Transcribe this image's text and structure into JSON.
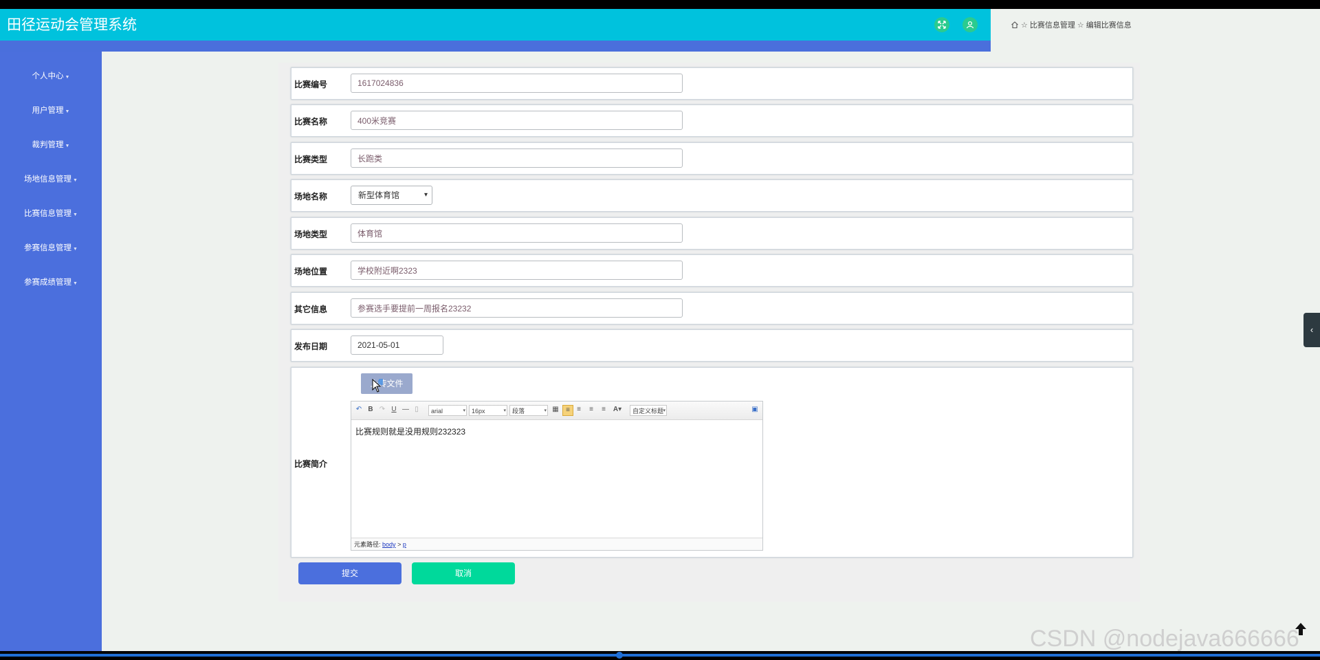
{
  "header": {
    "title": "田径运动会管理系统"
  },
  "breadcrumb": [
    "比赛信息管理",
    "编辑比赛信息"
  ],
  "sidebar": {
    "items": [
      {
        "label": "个人中心"
      },
      {
        "label": "用户管理"
      },
      {
        "label": "裁判管理"
      },
      {
        "label": "场地信息管理"
      },
      {
        "label": "比赛信息管理"
      },
      {
        "label": "参赛信息管理"
      },
      {
        "label": "参赛成绩管理"
      }
    ]
  },
  "form": {
    "match_no": {
      "label": "比赛编号",
      "value": "1617024836"
    },
    "match_name": {
      "label": "比赛名称",
      "value": "400米竞赛"
    },
    "match_type": {
      "label": "比赛类型",
      "value": "长跑类"
    },
    "venue_name": {
      "label": "场地名称",
      "value": "新型体育馆"
    },
    "venue_type": {
      "label": "场地类型",
      "value": "体育馆"
    },
    "venue_location": {
      "label": "场地位置",
      "value": "学校附近啊2323"
    },
    "other_info": {
      "label": "其它信息",
      "value": "参赛选手要提前一周报名23232"
    },
    "publish_date": {
      "label": "发布日期",
      "value": "2021-05-01"
    },
    "intro": {
      "label": "比赛简介",
      "upload_label": "上传文件",
      "toolbar": {
        "font": "arial",
        "size": "16px",
        "paragraph": "段落",
        "custom_title": "自定义标题"
      },
      "content": "比赛规则就是没用规则232323",
      "status_prefix": "元素路径:",
      "path_body": "body",
      "path_sep": ">",
      "path_p": "p"
    }
  },
  "actions": {
    "submit": "提交",
    "cancel": "取消"
  },
  "watermark": "CSDN @nodejava666666",
  "colors": {
    "header": "#00c2dd",
    "sidebar": "#4b6fdd",
    "submit": "#4b6fdd",
    "cancel": "#00d99b"
  }
}
